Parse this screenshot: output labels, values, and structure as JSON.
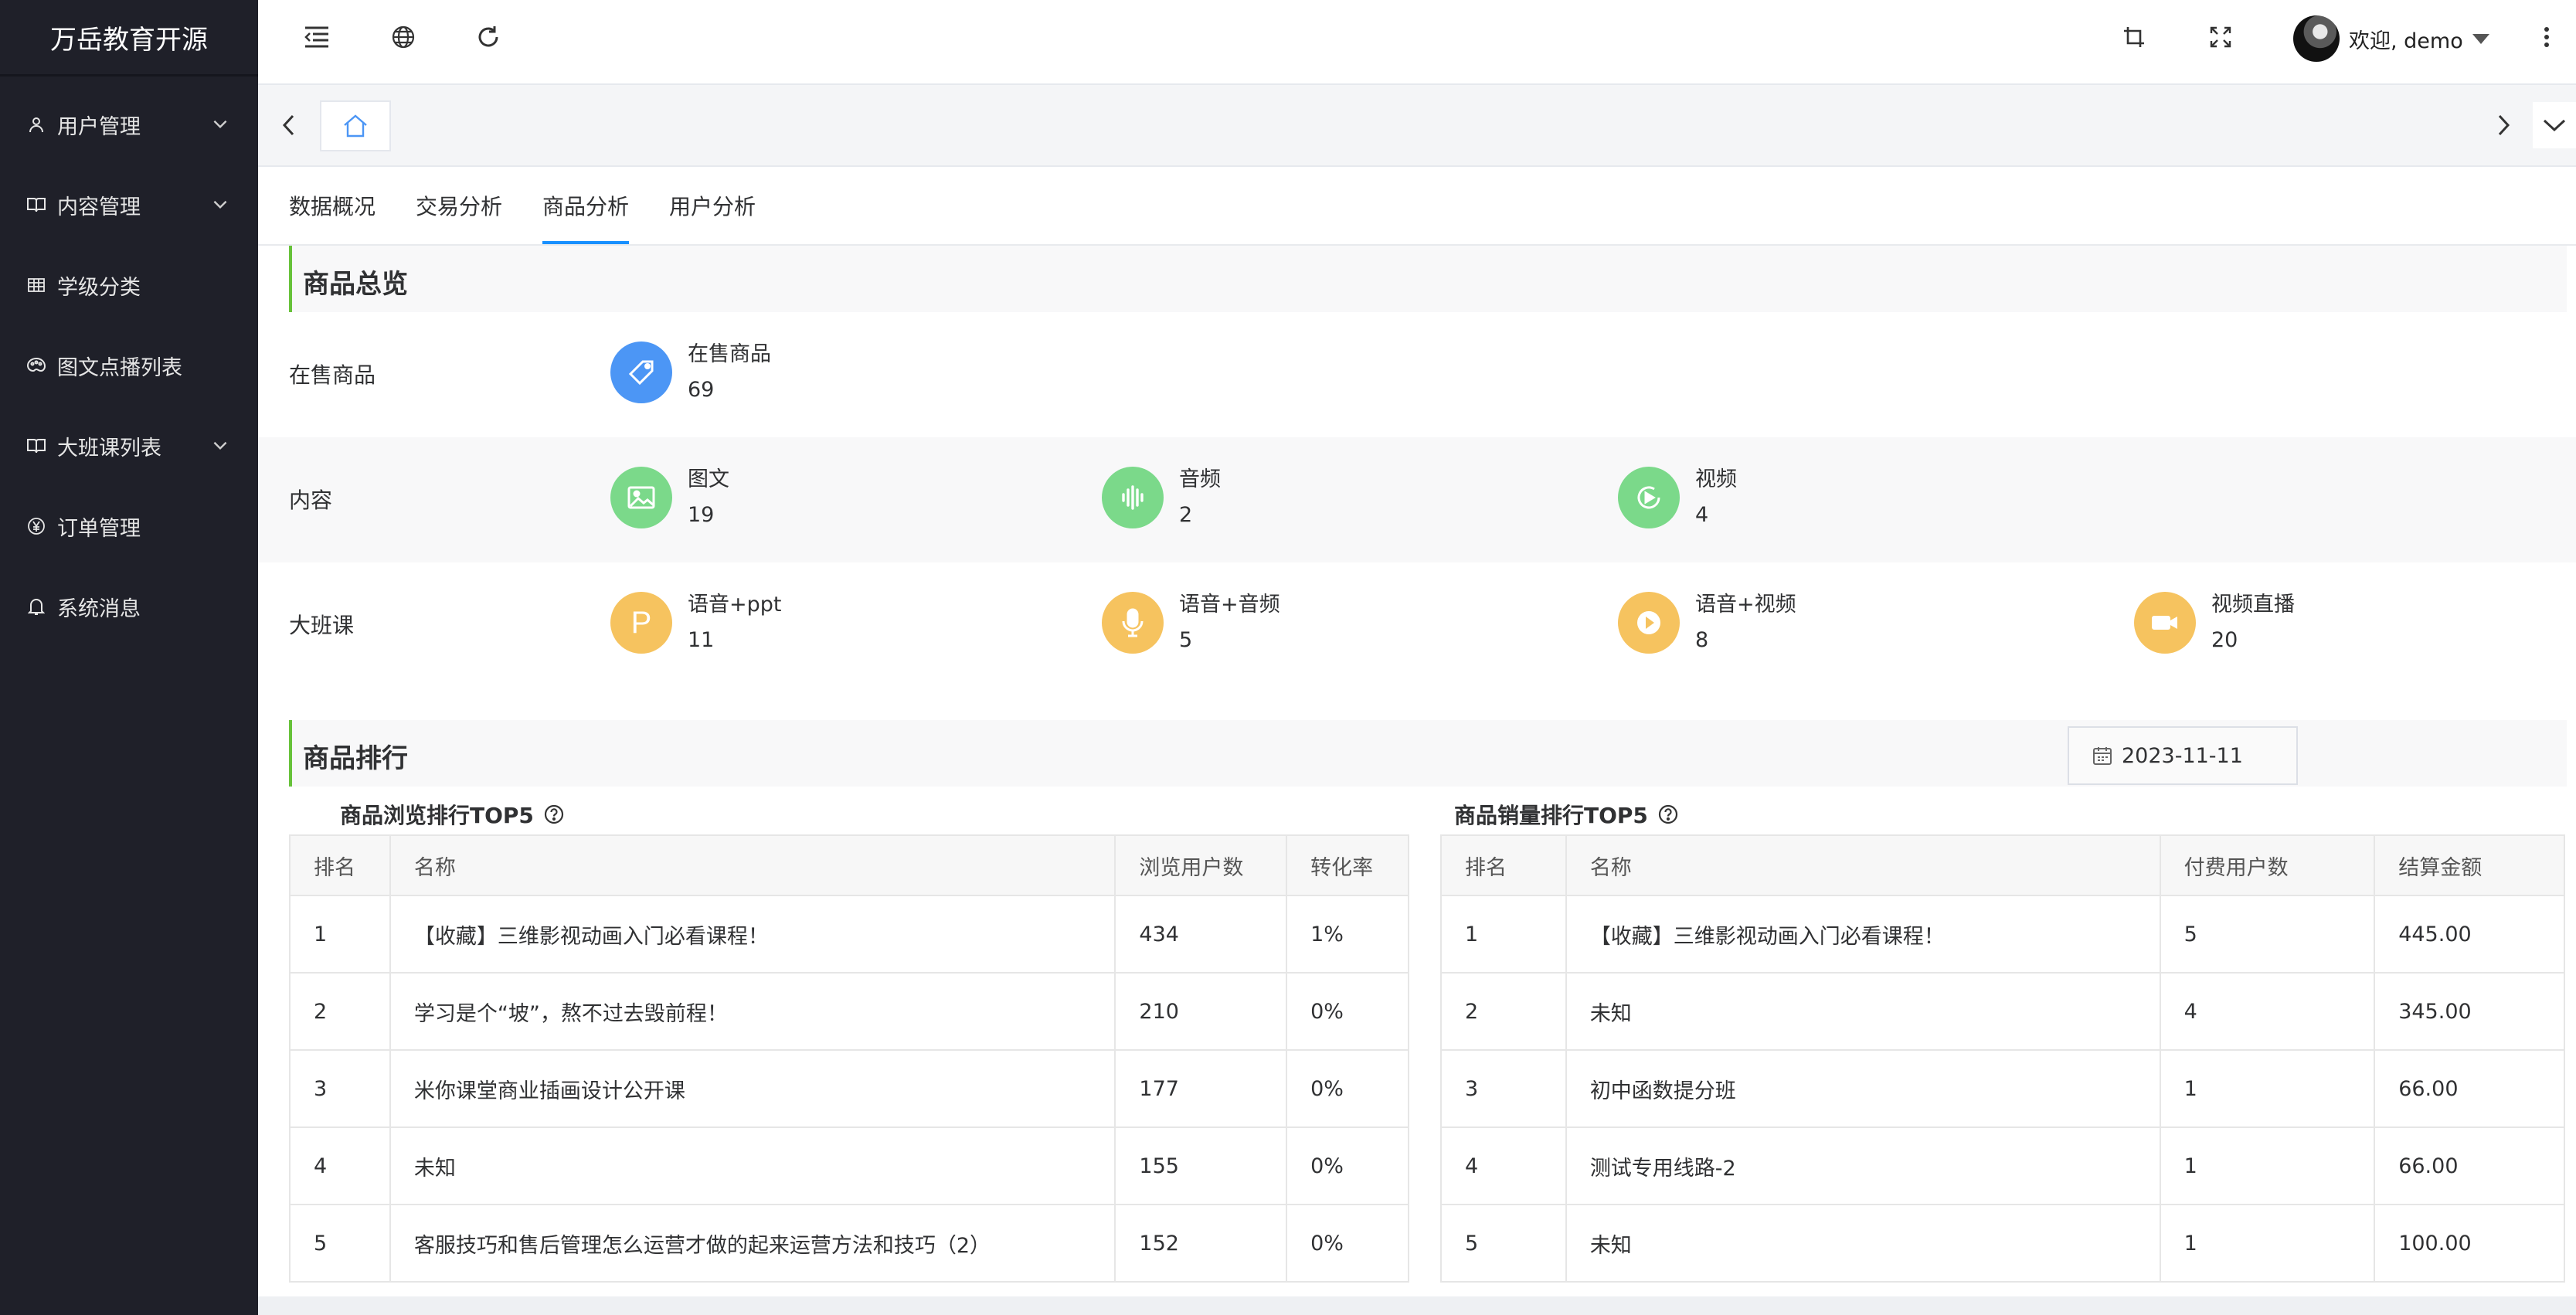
{
  "app": {
    "brand": "万岳教育开源"
  },
  "sidebar": {
    "items": [
      {
        "label": "用户管理",
        "icon": "user-icon",
        "expandable": true
      },
      {
        "label": "内容管理",
        "icon": "book-icon",
        "expandable": true
      },
      {
        "label": "学级分类",
        "icon": "grid-icon",
        "expandable": false
      },
      {
        "label": "图文点播列表",
        "icon": "palette-icon",
        "expandable": false
      },
      {
        "label": "大班课列表",
        "icon": "book-icon",
        "expandable": true
      },
      {
        "label": "订单管理",
        "icon": "yen-icon",
        "expandable": false
      },
      {
        "label": "系统消息",
        "icon": "bell-icon",
        "expandable": false
      }
    ]
  },
  "header": {
    "icons": [
      "indent-icon",
      "globe-icon",
      "refresh-icon",
      "crop-icon",
      "fullscreen-icon",
      "more-icon"
    ],
    "user_greeting": "欢迎, demo"
  },
  "tabs": [
    "数据概况",
    "交易分析",
    "商品分析",
    "用户分析"
  ],
  "active_tab": "商品分析",
  "overview": {
    "title": "商品总览",
    "on_sale": {
      "label": "在售商品",
      "items": [
        {
          "name": "在售商品",
          "value": "69",
          "color": "#4c96f5",
          "icon": "tag-icon"
        }
      ]
    },
    "content": {
      "label": "内容",
      "items": [
        {
          "name": "图文",
          "value": "19",
          "color": "#7bd98a",
          "icon": "image-icon"
        },
        {
          "name": "音频",
          "value": "2",
          "color": "#7bd98a",
          "icon": "audio-icon"
        },
        {
          "name": "视频",
          "value": "4",
          "color": "#7bd98a",
          "icon": "video-icon"
        }
      ]
    },
    "big_class": {
      "label": "大班课",
      "items": [
        {
          "name": "语音+ppt",
          "value": "11",
          "color": "#f6c35f",
          "icon": "ppt-icon"
        },
        {
          "name": "语音+音频",
          "value": "5",
          "color": "#f6c35f",
          "icon": "microphone-icon"
        },
        {
          "name": "语音+视频",
          "value": "8",
          "color": "#f6c35f",
          "icon": "play-icon"
        },
        {
          "name": "视频直播",
          "value": "20",
          "color": "#f6c35f",
          "icon": "camera-icon"
        }
      ]
    }
  },
  "ranking": {
    "title": "商品排行",
    "date": "2023-11-11",
    "browse": {
      "title": "商品浏览排行TOP5",
      "headers": [
        "排名",
        "名称",
        "浏览用户数",
        "转化率"
      ],
      "rows": [
        [
          "1",
          "【收藏】三维影视动画入门必看课程！",
          "434",
          "1%"
        ],
        [
          "2",
          "学习是个“坡”，熬不过去毁前程！",
          "210",
          "0%"
        ],
        [
          "3",
          "米你课堂商业插画设计公开课",
          "177",
          "0%"
        ],
        [
          "4",
          "未知",
          "155",
          "0%"
        ],
        [
          "5",
          "客服技巧和售后管理怎么运营才做的起来运营方法和技巧（2）",
          "152",
          "0%"
        ]
      ]
    },
    "sales": {
      "title": "商品销量排行TOP5",
      "headers": [
        "排名",
        "名称",
        "付费用户数",
        "结算金额"
      ],
      "rows": [
        [
          "1",
          "【收藏】三维影视动画入门必看课程！",
          "5",
          "445.00"
        ],
        [
          "2",
          "未知",
          "4",
          "345.00"
        ],
        [
          "3",
          "初中函数提分班",
          "1",
          "66.00"
        ],
        [
          "4",
          "测试专用线路-2",
          "1",
          "66.00"
        ],
        [
          "5",
          "未知",
          "1",
          "100.00"
        ]
      ]
    }
  }
}
